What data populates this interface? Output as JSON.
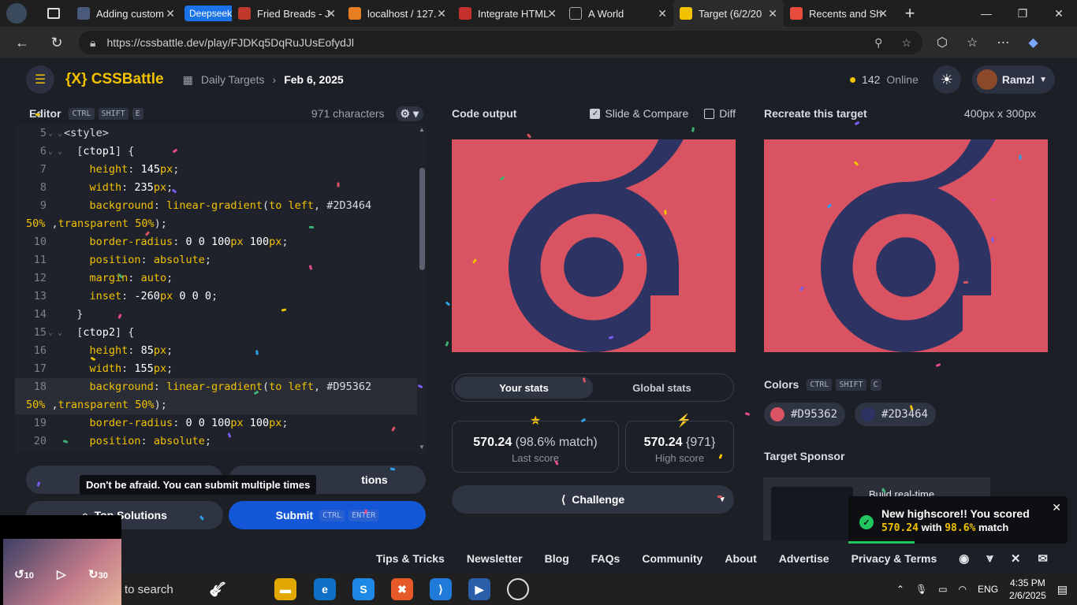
{
  "browser": {
    "tabs": [
      {
        "label": "Adding custom",
        "fav": "#4a5a7a"
      },
      {
        "label": "Fried Breads - J",
        "fav": "#c0392b"
      },
      {
        "label": "localhost / 127.",
        "fav": "#e67e22"
      },
      {
        "label": "Integrate HTML",
        "fav": "#c4302b"
      },
      {
        "label": "A World",
        "fav": "#555555"
      },
      {
        "label": "Target (6/2/20",
        "fav": "#f2c200"
      },
      {
        "label": "Recents and Sh",
        "fav": "#e74c3c"
      }
    ],
    "group_label": "Deepseek",
    "url": "https://cssbattle.dev/play/FJDKq5DqRuJUsEofydJl"
  },
  "app": {
    "logo": "{X} CSSBattle",
    "breadcrumb_root": "Daily Targets",
    "breadcrumb_current": "Feb 6, 2025",
    "online_count": "142",
    "online_label": "Online",
    "username": "Ramzl"
  },
  "editor": {
    "title": "Editor",
    "shortcut": [
      "CTRL",
      "SHIFT",
      "E"
    ],
    "char_count": "971 characters",
    "lines": [
      {
        "n": "5",
        "fold": "⌄ ⌄",
        "html": "<span class='s'>&lt;style&gt;</span>"
      },
      {
        "n": "6",
        "fold": "⌄ ⌄",
        "html": "  <span class='s'>[</span><span class='n'>ctop1</span><span class='s'>] {</span>"
      },
      {
        "n": "7",
        "fold": "",
        "html": "    <span class='p'>height</span>: <span class='n'>145</span><span class='p'>px</span>;"
      },
      {
        "n": "8",
        "fold": "",
        "html": "    <span class='p'>width</span>: <span class='n'>235</span><span class='p'>px</span>;"
      },
      {
        "n": "9",
        "fold": "",
        "html": "    <span class='p'>background</span>: <span class='k'>linear-gradient</span>(<span class='k'>to left</span>, #2D3464"
      },
      {
        "n": "",
        "fold": "",
        "html": "<span class='k'>50%</span> ,<span class='k'>transparent</span> <span class='k'>50%</span>);"
      },
      {
        "n": "10",
        "fold": "",
        "html": "    <span class='p'>border-radius</span>: <span class='n'>0 0 100</span><span class='p'>px</span> <span class='n'>100</span><span class='p'>px</span>;"
      },
      {
        "n": "11",
        "fold": "",
        "html": "    <span class='p'>position</span>: <span class='k'>absolute</span>;"
      },
      {
        "n": "12",
        "fold": "",
        "html": "    <span class='p'>margin</span>: <span class='k'>auto</span>;"
      },
      {
        "n": "13",
        "fold": "",
        "html": "    <span class='p'>inset</span>: <span class='n'>-260</span><span class='p'>px</span> <span class='n'>0 0 0</span>;"
      },
      {
        "n": "14",
        "fold": "",
        "html": "  <span class='s'>}</span>"
      },
      {
        "n": "15",
        "fold": "⌄ ⌄",
        "html": "  <span class='s'>[</span><span class='n'>ctop2</span><span class='s'>] {</span>"
      },
      {
        "n": "16",
        "fold": "",
        "html": "    <span class='p'>height</span>: <span class='n'>85</span><span class='p'>px</span>;"
      },
      {
        "n": "17",
        "fold": "",
        "html": "    <span class='p'>width</span>: <span class='n'>155</span><span class='p'>px</span>;"
      },
      {
        "n": "18",
        "fold": "",
        "hl": true,
        "html": "    <span class='p'>background</span>: <span class='k'>linear-gradient</span>(<span class='k'>to left</span>, #D95362"
      },
      {
        "n": "",
        "fold": "",
        "hl": true,
        "html": "<span class='k'>50%</span> ,<span class='k'>transparent</span> <span class='k'>50%</span>);"
      },
      {
        "n": "19",
        "fold": "",
        "html": "    <span class='p'>border-radius</span>: <span class='n'>0 0 100</span><span class='p'>px</span> <span class='n'>100</span><span class='p'>px</span>;"
      },
      {
        "n": "20",
        "fold": "",
        "html": "    <span class='p'>position</span>: <span class='k'>absolute</span>;"
      }
    ],
    "tooltip": "Don't be afraid. You can submit multiple times",
    "solutions_label": "tions",
    "top_solutions_label": "Top Solutions",
    "submit_label": "Submit",
    "submit_keys": [
      "CTRL",
      "ENTER"
    ]
  },
  "output": {
    "title": "Code output",
    "slide_compare_label": "Slide & Compare",
    "diff_label": "Diff",
    "stats_tabs": [
      "Your stats",
      "Global stats"
    ],
    "last_score": "570.24",
    "last_match": "(98.6% match)",
    "last_label": "Last score",
    "high_score": "570.24",
    "high_chars": "{971}",
    "high_label": "High score",
    "challenge_label": "Challenge"
  },
  "target": {
    "title": "Recreate this target",
    "size": "400px x 300px",
    "colors_label": "Colors",
    "colors_shortcut": [
      "CTRL",
      "SHIFT",
      "C"
    ],
    "colors": [
      {
        "hex": "#D95362"
      },
      {
        "hex": "#2D3464"
      }
    ],
    "sponsor_label": "Target Sponsor",
    "sponsor_text": "Build real-time"
  },
  "toast": {
    "line1": "New highscore!! You scored",
    "score": "570.24",
    "with": "with",
    "match": "98.6%",
    "match_suffix": "match"
  },
  "footer": {
    "links": [
      "Tips & Tricks",
      "Newsletter",
      "Blog",
      "FAQs",
      "Community",
      "About",
      "Advertise",
      "Privacy & Terms"
    ]
  },
  "taskbar": {
    "search_placeholder": "to search",
    "time": "4:35 PM",
    "date": "2/6/2025",
    "lang": "ENG",
    "video_back": "10",
    "video_fwd": "30"
  },
  "colors": {
    "accent": "#f2c200",
    "shape_bg": "#D95362",
    "shape_fg": "#2D3464",
    "submit": "#1357d6"
  }
}
